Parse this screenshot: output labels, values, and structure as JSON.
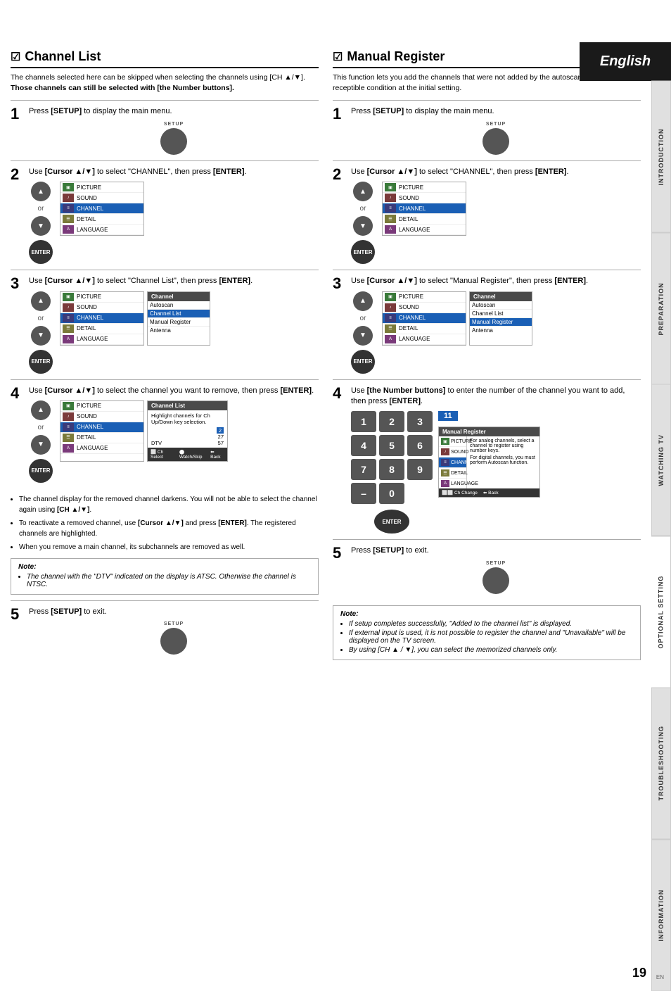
{
  "header": {
    "language": "English"
  },
  "sidebar": {
    "tabs": [
      "INTRODUCTION",
      "PREPARATION",
      "WATCHING TV",
      "OPTIONAL SETTING",
      "TROUBLESHOOTING",
      "INFORMATION"
    ]
  },
  "left_section": {
    "title": "Channel List",
    "checkmark": "☑",
    "desc_line1": "The channels selected here can be skipped when selecting the channels using [CH ▲/▼].",
    "desc_line2": "Those channels can still be selected with [the Number buttons].",
    "steps": [
      {
        "number": "1",
        "text": "Press [SETUP] to display the main menu.",
        "setup_label": "SETUP"
      },
      {
        "number": "2",
        "text": "Use [Cursor ▲/▼] to select \"CHANNEL\", then press [ENTER].",
        "menu_title": "",
        "menu_items": [
          "PICTURE",
          "SOUND",
          "CHANNEL",
          "DETAIL",
          "LANGUAGE"
        ],
        "menu_highlighted": "CHANNEL"
      },
      {
        "number": "3",
        "text": "Use [Cursor ▲/▼] to select \"Channel List\", then press [ENTER].",
        "channel_menu_title": "Channel",
        "channel_items": [
          "Autoscan",
          "Channel List",
          "Manual Register",
          "Antenna"
        ],
        "channel_highlighted": "Channel List"
      },
      {
        "number": "4",
        "text": "Use [Cursor ▲/▼] to select the channel you want to remove, then press [ENTER].",
        "ch_list_title": "Channel List",
        "ch_list_desc": "Highlight channels for Ch Up/Down key selection.",
        "ch_list_numbers": [
          "2",
          "27",
          "",
          "",
          "",
          "57"
        ],
        "ch_list_footer": [
          "Ch Select",
          "Watch/Skip",
          "Back"
        ]
      }
    ],
    "bullets": [
      "The channel display for the removed channel darkens. You will not be able to select the channel again using [CH ▲/▼].",
      "To reactivate a removed channel, use [Cursor ▲/▼] and press [ENTER]. The registered channels are highlighted.",
      "When you remove a main channel, its subchannels are removed as well."
    ],
    "note": {
      "title": "Note:",
      "items": [
        "The channel with the \"DTV\" indicated on the display is ATSC. Otherwise the channel is NTSC."
      ]
    },
    "step5": {
      "number": "5",
      "text": "Press [SETUP] to exit.",
      "setup_label": "SETUP"
    }
  },
  "right_section": {
    "title": "Manual Register",
    "checkmark": "☑",
    "desc": "This function lets you add the channels that were not added by the autoscan due to the receptible condition at the initial setting.",
    "steps": [
      {
        "number": "1",
        "text": "Press [SETUP] to display the main menu.",
        "setup_label": "SETUP"
      },
      {
        "number": "2",
        "text": "Use [Cursor ▲/▼] to select \"CHANNEL\", then press [ENTER].",
        "menu_items": [
          "PICTURE",
          "SOUND",
          "CHANNEL",
          "DETAIL",
          "LANGUAGE"
        ],
        "menu_highlighted": "CHANNEL"
      },
      {
        "number": "3",
        "text": "Use [Cursor ▲/▼] to select \"Manual Register\", then press [ENTER].",
        "channel_items": [
          "Autoscan",
          "Channel List",
          "Manual Register",
          "Antenna"
        ],
        "channel_highlighted": "Manual Register"
      },
      {
        "number": "4",
        "text": "Use [the Number buttons] to enter the number of the channel you want to add, then press [ENTER].",
        "channel_badge": "11",
        "manual_reg_title": "Manual Register",
        "manual_reg_items": [
          "PICTURE",
          "SOUND",
          "CHANNEL",
          "DETAIL",
          "LANGUAGE"
        ],
        "manual_reg_desc1": "For analog channels, select a channel to register using number keys.",
        "manual_reg_desc2": "For digital channels, you must perform Autoscan function.",
        "manual_reg_footer": [
          "Ch Change",
          "Back"
        ]
      }
    ],
    "step5": {
      "number": "5",
      "text": "Press [SETUP] to exit.",
      "setup_label": "SETUP"
    },
    "note": {
      "title": "Note:",
      "items": [
        "If setup completes successfully, \"Added to the channel list\" is displayed.",
        "If external input is used, it is not possible to register the channel and \"Unavailable\" will be displayed on the TV screen.",
        "By using [CH ▲ / ▼], you can select the memorized channels only."
      ]
    }
  },
  "page_number": "19",
  "page_en": "EN"
}
